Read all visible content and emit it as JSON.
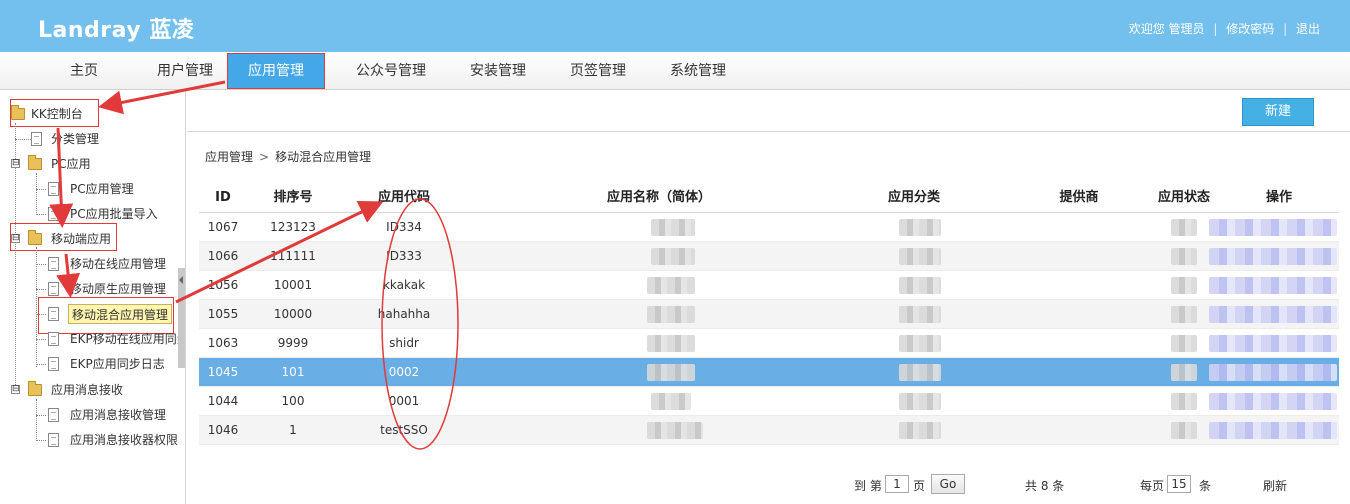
{
  "header": {
    "logo_latin": "Landray",
    "logo_cn": "蓝凌",
    "welcome": "欢迎您",
    "user": "管理员",
    "change_password": "修改密码",
    "logout": "退出",
    "separator": "|"
  },
  "nav": {
    "items": [
      {
        "label": "主页"
      },
      {
        "label": "用户管理"
      },
      {
        "label": "应用管理"
      },
      {
        "label": "公众号管理"
      },
      {
        "label": "安装管理"
      },
      {
        "label": "页签管理"
      },
      {
        "label": "系统管理"
      }
    ],
    "active_index": 2
  },
  "sidebar": {
    "root": "KK控制台",
    "category": "分类管理",
    "pc_group": "PC应用",
    "pc_items": [
      "PC应用管理",
      "PC应用批量导入"
    ],
    "mobile_group": "移动端应用",
    "mobile_items": [
      "移动在线应用管理",
      "移动原生应用管理",
      "移动混合应用管理",
      "EKP移动在线应用同步",
      "EKP应用同步日志"
    ],
    "msg_group": "应用消息接收",
    "msg_items": [
      "应用消息接收管理",
      "应用消息接收器权限"
    ],
    "toggle_collapsed": "⊟"
  },
  "toolbar": {
    "new_label": "新建"
  },
  "breadcrumb": {
    "parent": "应用管理",
    "arrow": ">",
    "current": "移动混合应用管理"
  },
  "table": {
    "columns": [
      "ID",
      "排序号",
      "应用代码",
      "应用名称（简体）",
      "应用分类",
      "提供商",
      "应用状态",
      "操作"
    ],
    "rows": [
      {
        "id": "1067",
        "order": "123123",
        "code": "ID334"
      },
      {
        "id": "1066",
        "order": "111111",
        "code": "ID333"
      },
      {
        "id": "1056",
        "order": "10001",
        "code": "kkakak"
      },
      {
        "id": "1055",
        "order": "10000",
        "code": "hahahha"
      },
      {
        "id": "1063",
        "order": "9999",
        "code": "shidr"
      },
      {
        "id": "1045",
        "order": "101",
        "code": "0002"
      },
      {
        "id": "1044",
        "order": "100",
        "code": "0001"
      },
      {
        "id": "1046",
        "order": "1",
        "code": "testSSO"
      }
    ],
    "selected_index": 5
  },
  "pager": {
    "goto_prefix": "到 第",
    "page": "1",
    "page_suffix": "页",
    "go": "Go",
    "total": "共 8 条",
    "per_page_prefix": "每页",
    "per_page": "15",
    "per_page_suffix": "条",
    "refresh": "刷新"
  },
  "colors": {
    "header_bg": "#73c0ee",
    "nav_active": "#44a8e8",
    "selected_row": "#6aaee6",
    "annotation_red": "#e03a3a"
  }
}
